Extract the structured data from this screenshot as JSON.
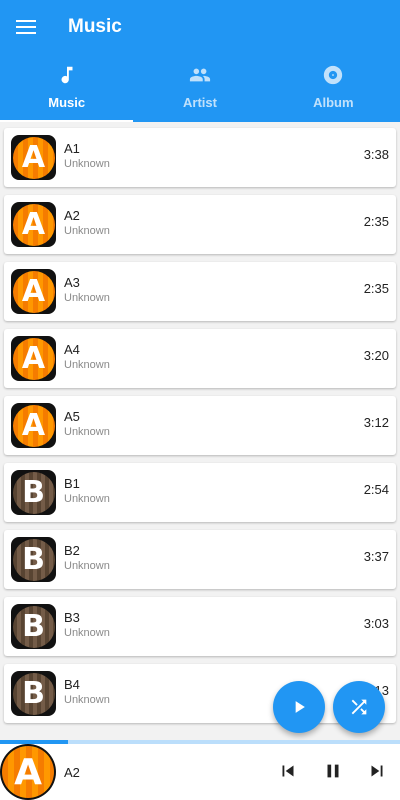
{
  "appbar": {
    "title": "Music",
    "menu_icon": "menu-icon"
  },
  "tabs": [
    {
      "label": "Music",
      "icon": "music-note-icon",
      "selected": true
    },
    {
      "label": "Artist",
      "icon": "people-icon",
      "selected": false
    },
    {
      "label": "Album",
      "icon": "album-icon",
      "selected": false
    }
  ],
  "songs": [
    {
      "art": "A",
      "title": "A1",
      "artist": "Unknown",
      "duration": "3:38"
    },
    {
      "art": "A",
      "title": "A2",
      "artist": "Unknown",
      "duration": "2:35"
    },
    {
      "art": "A",
      "title": "A3",
      "artist": "Unknown",
      "duration": "2:35"
    },
    {
      "art": "A",
      "title": "A4",
      "artist": "Unknown",
      "duration": "3:20"
    },
    {
      "art": "A",
      "title": "A5",
      "artist": "Unknown",
      "duration": "3:12"
    },
    {
      "art": "B",
      "title": "B1",
      "artist": "Unknown",
      "duration": "2:54"
    },
    {
      "art": "B",
      "title": "B2",
      "artist": "Unknown",
      "duration": "3:37"
    },
    {
      "art": "B",
      "title": "B3",
      "artist": "Unknown",
      "duration": "3:03"
    },
    {
      "art": "B",
      "title": "B4",
      "artist": "Unknown",
      "duration": "3:13"
    }
  ],
  "fabs": {
    "play_icon": "play-icon",
    "shuffle_icon": "shuffle-icon"
  },
  "player": {
    "title": "A2",
    "art": "A",
    "progress": 0.17,
    "prev_icon": "skip-previous-icon",
    "pause_icon": "pause-icon",
    "next_icon": "skip-next-icon"
  },
  "colors": {
    "primary": "#2196f3",
    "track": "#bbdefb",
    "art_a": "#ff9800",
    "art_b": "#a08c78"
  }
}
